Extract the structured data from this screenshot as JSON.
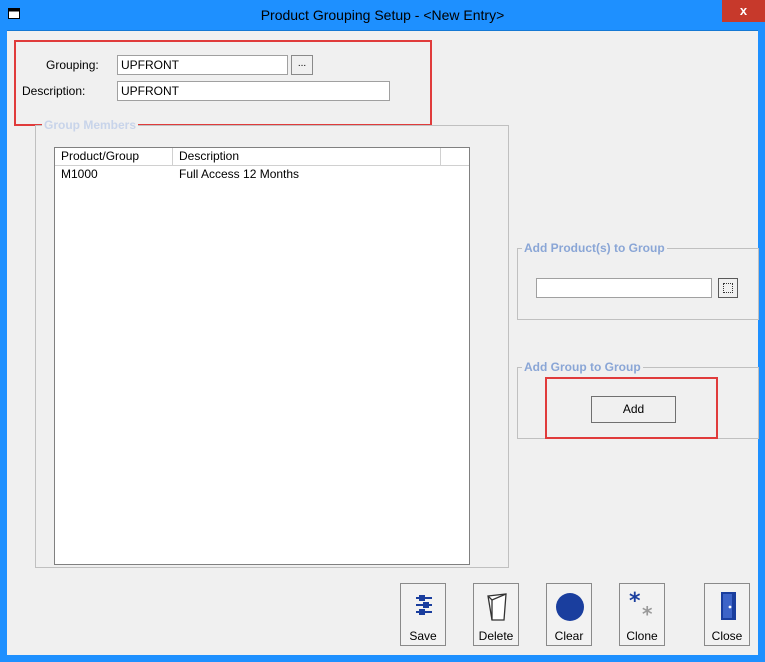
{
  "window": {
    "title": "Product Grouping Setup - <New Entry>",
    "close_label": "x"
  },
  "form": {
    "grouping_label": "Grouping:",
    "grouping_value": "UPFRONT",
    "browse_label": "...",
    "description_label": "Description:",
    "description_value": "UPFRONT"
  },
  "group_members": {
    "legend": "Group Members",
    "columns": [
      "Product/Group",
      "Description"
    ],
    "rows": [
      {
        "product": "M1000",
        "description": "Full Access 12 Months"
      }
    ]
  },
  "add_products": {
    "legend": "Add Product(s) to Group",
    "input_value": ""
  },
  "add_group": {
    "legend": "Add Group to Group",
    "add_label": "Add"
  },
  "toolbar": {
    "save_label": "Save",
    "delete_label": "Delete",
    "clear_label": "Clear",
    "clone_label": "Clone",
    "close_label": "Close"
  },
  "colors": {
    "titlebar": "#1e90ff",
    "highlight": "#e03b3b",
    "legend_text": "#8aa6d6",
    "clear_icon": "#1a3e9e"
  },
  "icons": [
    "window-icon",
    "save-icon",
    "delete-icon",
    "clear-icon",
    "clone-icon",
    "close-door-icon"
  ]
}
